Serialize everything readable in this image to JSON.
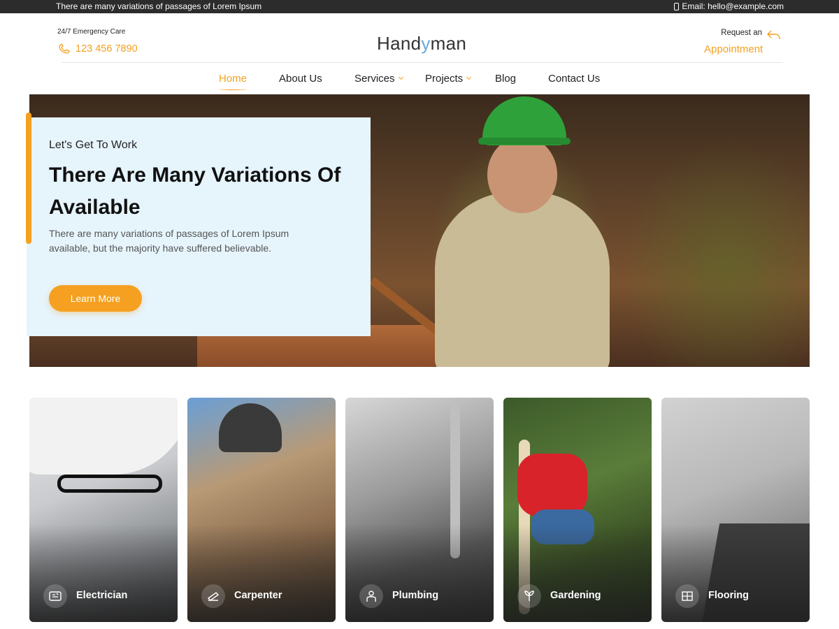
{
  "topbar": {
    "message": "There are many variations of passages of Lorem Ipsum",
    "email": "Email: hello@example.com"
  },
  "header": {
    "emergency_label": "24/7 Emergency Care",
    "phone": "123 456 7890",
    "logo_part1": "Hand",
    "logo_y": "y",
    "logo_part2": "man",
    "request_top": "Request an",
    "request_bottom": "Appointment"
  },
  "nav": {
    "items": [
      {
        "label": "Home",
        "active": true
      },
      {
        "label": "About Us"
      },
      {
        "label": "Services",
        "dropdown": true
      },
      {
        "label": "Projects",
        "dropdown": true
      },
      {
        "label": "Blog"
      },
      {
        "label": "Contact Us"
      }
    ]
  },
  "hero": {
    "kicker": "Let's Get To Work",
    "title": "There Are Many Variations Of Available",
    "text": "There are many variations of passages of Lorem Ipsum available, but the majority have suffered  believable.",
    "button": "Learn More"
  },
  "services": [
    {
      "label": "Electrician",
      "icon": "electric-meter-icon"
    },
    {
      "label": "Carpenter",
      "icon": "saw-icon"
    },
    {
      "label": "Plumbing",
      "icon": "plumber-icon"
    },
    {
      "label": "Gardening",
      "icon": "gardening-icon"
    },
    {
      "label": "Flooring",
      "icon": "flooring-icon"
    }
  ],
  "colors": {
    "accent": "#f5a020",
    "hero_card_bg": "#e6f4fc",
    "topbar_bg": "#2c2c2c"
  }
}
